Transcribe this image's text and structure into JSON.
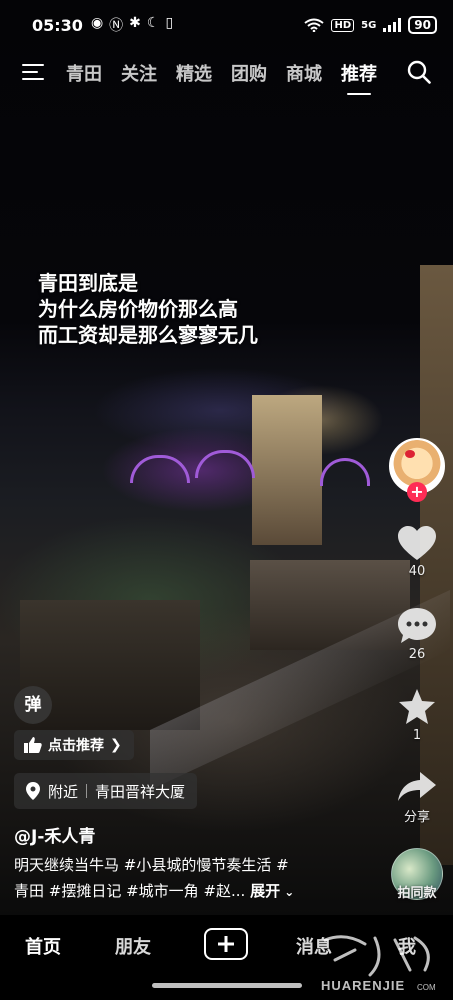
{
  "status_bar": {
    "time": "05:30",
    "left_icons": [
      "eye-icon",
      "nfc-icon",
      "bluetooth-icon",
      "moon-icon",
      "vibrate-icon"
    ],
    "network": "5G",
    "hd": "HD",
    "battery": "90"
  },
  "top_nav": {
    "tabs": [
      {
        "label": "青田",
        "active": false
      },
      {
        "label": "关注",
        "active": false
      },
      {
        "label": "精选",
        "active": false
      },
      {
        "label": "团购",
        "active": false
      },
      {
        "label": "商城",
        "active": false
      },
      {
        "label": "推荐",
        "active": true
      }
    ]
  },
  "caption": {
    "lines": [
      "青田到底是",
      "为什么房价物价那么高",
      "而工资却是那么寥寥无几"
    ]
  },
  "right_rail": {
    "like_count": "40",
    "comment_count": "26",
    "favorite_count": "1",
    "share_label": "分享",
    "same_label": "拍同款"
  },
  "bottom_left": {
    "circle_label": "弹",
    "recommend_label": "点击推荐",
    "location_prefix": "附近",
    "location_name": "青田晋祥大厦",
    "username": "@J-禾人青",
    "desc_line1": "明天继续当牛马 #小县城的慢节奏生活 #",
    "desc_line2": "青田 #摆摊日记 #城市一角 #赵...",
    "expand_label": "展开"
  },
  "tab_bar": {
    "home": "首页",
    "friends": "朋友",
    "messages": "消息",
    "me": "我"
  },
  "watermark": {
    "text": "HUARENJIE",
    "suffix": "COM"
  },
  "colors": {
    "accent_red": "#fe2c55",
    "bridge_purple": "#a05bd8"
  }
}
